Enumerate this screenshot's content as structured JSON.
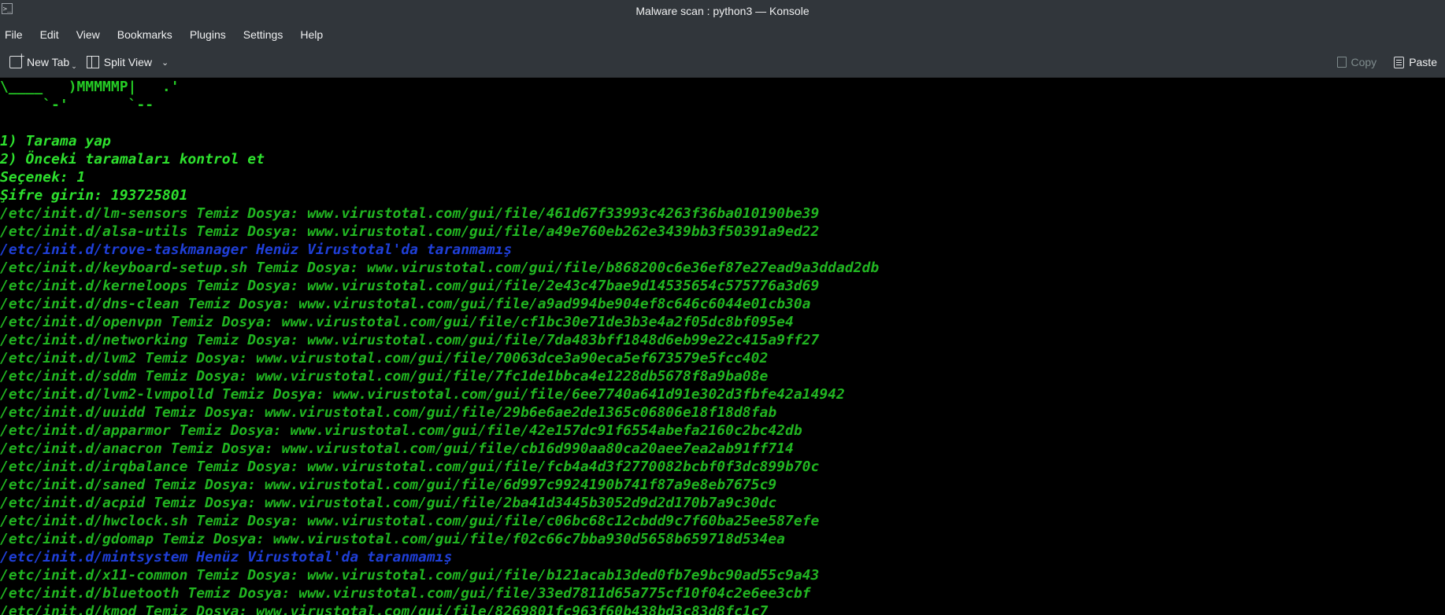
{
  "window": {
    "title": "Malware scan : python3 — Konsole"
  },
  "menubar": [
    "File",
    "Edit",
    "View",
    "Bookmarks",
    "Plugins",
    "Settings",
    "Help"
  ],
  "toolbar": {
    "new_tab": "New Tab",
    "split_view": "Split View",
    "copy": "Copy",
    "paste": "Paste"
  },
  "terminal": {
    "lines": [
      {
        "text": "\\____   )MMMMMP|   .'",
        "style": "art"
      },
      {
        "text": "     `-'       `--",
        "style": "art"
      },
      {
        "text": "",
        "style": "g"
      },
      {
        "text": "1) Tarama yap",
        "style": "hl"
      },
      {
        "text": "2) Önceki taramaları kontrol et",
        "style": "hl"
      },
      {
        "text": "Seçenek: 1",
        "style": "hl"
      },
      {
        "text": "Şifre girin: 193725801",
        "style": "hl"
      },
      {
        "text": "/etc/init.d/lm-sensors Temiz Dosya: www.virustotal.com/gui/file/461d67f33993c4263f36ba010190be39",
        "style": "g"
      },
      {
        "text": "/etc/init.d/alsa-utils Temiz Dosya: www.virustotal.com/gui/file/a49e760eb262e3439bb3f50391a9ed22",
        "style": "g"
      },
      {
        "text": "/etc/init.d/trove-taskmanager Henüz Virustotal'da taranmamış",
        "style": "b"
      },
      {
        "text": "/etc/init.d/keyboard-setup.sh Temiz Dosya: www.virustotal.com/gui/file/b868200c6e36ef87e27ead9a3ddad2db",
        "style": "g"
      },
      {
        "text": "/etc/init.d/kerneloops Temiz Dosya: www.virustotal.com/gui/file/2e43c47bae9d14535654c575776a3d69",
        "style": "g"
      },
      {
        "text": "/etc/init.d/dns-clean Temiz Dosya: www.virustotal.com/gui/file/a9ad994be904ef8c646c6044e01cb30a",
        "style": "g"
      },
      {
        "text": "/etc/init.d/openvpn Temiz Dosya: www.virustotal.com/gui/file/cf1bc30e71de3b3e4a2f05dc8bf095e4",
        "style": "g"
      },
      {
        "text": "/etc/init.d/networking Temiz Dosya: www.virustotal.com/gui/file/7da483bff1848d6eb99e22c415a9ff27",
        "style": "g"
      },
      {
        "text": "/etc/init.d/lvm2 Temiz Dosya: www.virustotal.com/gui/file/70063dce3a90eca5ef673579e5fcc402",
        "style": "g"
      },
      {
        "text": "/etc/init.d/sddm Temiz Dosya: www.virustotal.com/gui/file/7fc1de1bbca4e1228db5678f8a9ba08e",
        "style": "g"
      },
      {
        "text": "/etc/init.d/lvm2-lvmpolld Temiz Dosya: www.virustotal.com/gui/file/6ee7740a641d91e302d3fbfe42a14942",
        "style": "g"
      },
      {
        "text": "/etc/init.d/uuidd Temiz Dosya: www.virustotal.com/gui/file/29b6e6ae2de1365c06806e18f18d8fab",
        "style": "g"
      },
      {
        "text": "/etc/init.d/apparmor Temiz Dosya: www.virustotal.com/gui/file/42e157dc91f6554abefa2160c2bc42db",
        "style": "g"
      },
      {
        "text": "/etc/init.d/anacron Temiz Dosya: www.virustotal.com/gui/file/cb16d990aa80ca20aee7ea2ab91ff714",
        "style": "g"
      },
      {
        "text": "/etc/init.d/irqbalance Temiz Dosya: www.virustotal.com/gui/file/fcb4a4d3f2770082bcbf0f3dc899b70c",
        "style": "g"
      },
      {
        "text": "/etc/init.d/saned Temiz Dosya: www.virustotal.com/gui/file/6d997c9924190b741f87a9e8eb7675c9",
        "style": "g"
      },
      {
        "text": "/etc/init.d/acpid Temiz Dosya: www.virustotal.com/gui/file/2ba41d3445b3052d9d2d170b7a9c30dc",
        "style": "g"
      },
      {
        "text": "/etc/init.d/hwclock.sh Temiz Dosya: www.virustotal.com/gui/file/c06bc68c12cbdd9c7f60ba25ee587efe",
        "style": "g"
      },
      {
        "text": "/etc/init.d/gdomap Temiz Dosya: www.virustotal.com/gui/file/f02c66c7bba930d5658b659718d534ea",
        "style": "g"
      },
      {
        "text": "/etc/init.d/mintsystem Henüz Virustotal'da taranmamış",
        "style": "b"
      },
      {
        "text": "/etc/init.d/x11-common Temiz Dosya: www.virustotal.com/gui/file/b121acab13ded0fb7e9bc90ad55c9a43",
        "style": "g"
      },
      {
        "text": "/etc/init.d/bluetooth Temiz Dosya: www.virustotal.com/gui/file/33ed7811d65a775cf10f04c2e6ee3cbf",
        "style": "g"
      },
      {
        "text": "/etc/init.d/kmod Temiz Dosya: www.virustotal.com/gui/file/8269801fc963f60b438bd3c83d8fc1c7",
        "style": "g"
      }
    ]
  }
}
